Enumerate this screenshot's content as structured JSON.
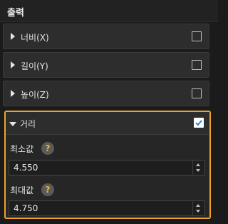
{
  "panel": {
    "title": "출력"
  },
  "sections": [
    {
      "label": "너비(X)",
      "checked": false
    },
    {
      "label": "길이(Y)",
      "checked": false
    },
    {
      "label": "높이(Z)",
      "checked": false
    },
    {
      "label": "거리",
      "checked": true
    }
  ],
  "distance": {
    "min_label": "최소값",
    "min_value": "4.550",
    "max_label": "최대값",
    "max_value": "4.750"
  },
  "icons": {
    "help": "?"
  },
  "colors": {
    "highlight_border": "#f0a22b",
    "help_icon": "#f0b431",
    "check_mark": "#1e7bd6"
  }
}
